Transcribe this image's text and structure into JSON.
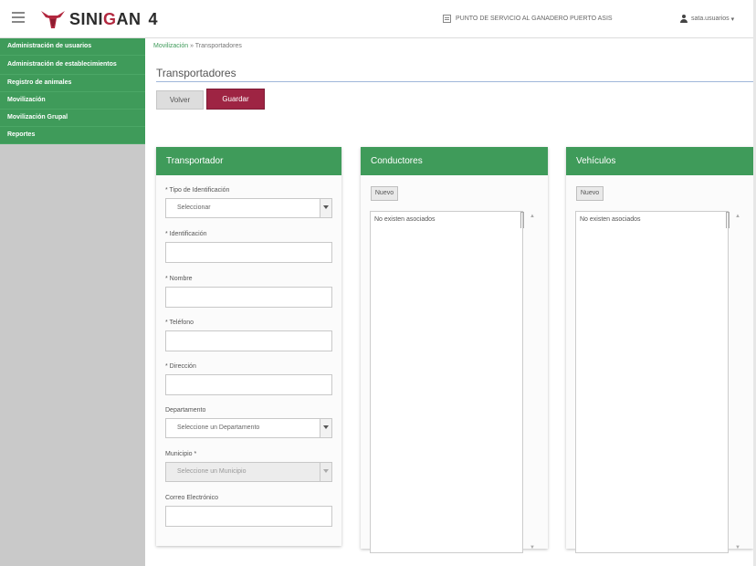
{
  "header": {
    "app_name_part1": "SINI",
    "app_name_part2": "G",
    "app_name_part3": "AN",
    "version": "4",
    "service_point": "PUNTO DE SERVICIO AL GANADERO PUERTO ASIS",
    "user": "sata.usuarios"
  },
  "sidebar": {
    "items": [
      {
        "label": "Administración de usuarios"
      },
      {
        "label": "Administración de establecimientos"
      },
      {
        "label": "Registro de animales"
      },
      {
        "label": "Movilización"
      },
      {
        "label": "Movilización Grupal"
      },
      {
        "label": "Reportes"
      }
    ]
  },
  "breadcrumb": {
    "parent": "Movilización",
    "separator": " » ",
    "current": "Transportadores"
  },
  "page": {
    "title": "Transportadores",
    "volver_label": "Volver",
    "guardar_label": "Guardar"
  },
  "transportador": {
    "title": "Transportador",
    "tipo_label": "* Tipo de Identificación",
    "tipo_value": "Seleccionar",
    "identificacion_label": "* Identificación",
    "nombre_label": "* Nombre",
    "telefono_label": "* Teléfono",
    "direccion_label": "* Dirección",
    "departamento_label": "Departamento",
    "departamento_value": "Seleccione un Departamento",
    "municipio_label": "Municipio *",
    "municipio_value": "Seleccione un Municipio",
    "correo_label": "Correo Electrónico"
  },
  "conductores": {
    "title": "Conductores",
    "nuevo_label": "Nuevo",
    "empty_text": "No existen asociados"
  },
  "vehiculos": {
    "title": "Vehículos",
    "nuevo_label": "Nuevo",
    "empty_text": "No existen asociados"
  },
  "colors": {
    "brand_green": "#3f9b5a",
    "brand_red": "#9e2443",
    "sidebar_bg": "#c9c9c9"
  }
}
